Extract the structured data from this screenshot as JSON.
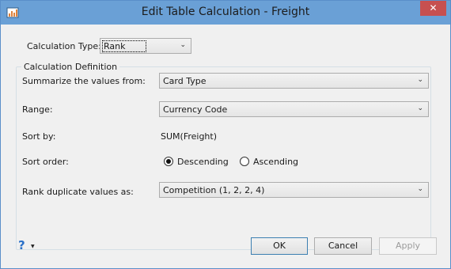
{
  "window": {
    "title": "Edit Table Calculation - Freight",
    "close_glyph": "✕"
  },
  "calculation_type": {
    "label": "Calculation Type:",
    "value": "Rank"
  },
  "definition": {
    "group_title": "Calculation Definition",
    "summarize": {
      "label": "Summarize the values from:",
      "value": "Card Type"
    },
    "range": {
      "label": "Range:",
      "value": "Currency Code"
    },
    "sort_by": {
      "label": "Sort by:",
      "value": "SUM(Freight)"
    },
    "sort_order": {
      "label": "Sort order:",
      "descending": "Descending",
      "ascending": "Ascending",
      "selected": "Descending"
    },
    "rank_duplicates": {
      "label": "Rank duplicate values as:",
      "value": "Competition (1, 2, 2, 4)"
    }
  },
  "buttons": {
    "ok": "OK",
    "cancel": "Cancel",
    "apply": "Apply"
  },
  "help": {
    "glyph": "?",
    "caret": "▼"
  },
  "icons": {
    "dropdown_arrow": "⌄"
  }
}
